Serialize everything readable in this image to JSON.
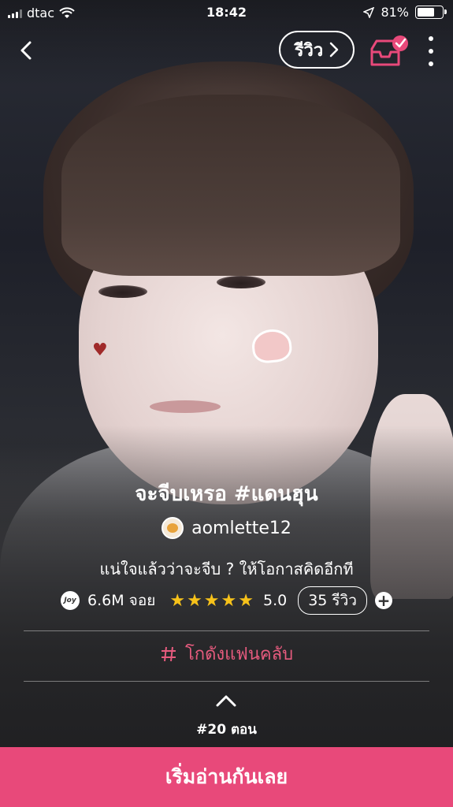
{
  "status_bar": {
    "carrier": "dtac",
    "time": "18:42",
    "battery": "81%",
    "battery_level": 0.81
  },
  "nav": {
    "back_icon": "chevron-left-icon",
    "review_label": "รีวิว",
    "inbox_icon": "inbox-check-icon",
    "more_icon": "more-vertical-icon"
  },
  "story": {
    "title": "จะจีบเหรอ #แดนฮุน",
    "author": "aomlette12",
    "description": "แน่ใจแล้วว่าจะจีบ ?  ให้โอกาสคิดอีกที",
    "joy_badge": "Joy",
    "reads": "6.6M จอย",
    "stars": "★★★★★",
    "rating_value": 5.0,
    "rating": "5.0",
    "review_count": "35 รีวิว",
    "fanclub_label": "โกดังแฟนคลับ",
    "episode": "#20 ตอน"
  },
  "cta": {
    "label": "เริ่มอ่านกันเลย"
  },
  "colors": {
    "accent": "#e8497a",
    "fanclub": "#e65b7e",
    "star": "#f7c21a"
  }
}
